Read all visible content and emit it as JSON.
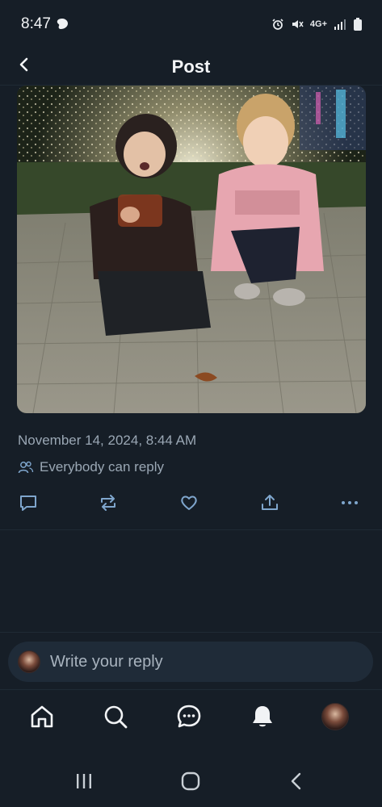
{
  "status_bar": {
    "time": "8:47",
    "network": "4G+"
  },
  "header": {
    "title": "Post"
  },
  "post": {
    "image_alt": "Two children posing in a lit light tunnel",
    "date": "November 14, 2024, 8:44 AM",
    "reply_permission": "Everybody can reply"
  },
  "actions": [
    "reply-icon",
    "repost-icon",
    "like-icon",
    "share-icon",
    "more-icon"
  ],
  "reply_bar": {
    "placeholder": "Write your reply"
  },
  "nav": [
    "home-icon",
    "search-icon",
    "messages-icon",
    "notifications-icon",
    "profile-avatar"
  ],
  "colors": {
    "background": "#161e27",
    "muted_text": "#9aa7b4",
    "icon_accent": "#7fa6cd",
    "reply_bar_bg": "#1f2b38"
  }
}
